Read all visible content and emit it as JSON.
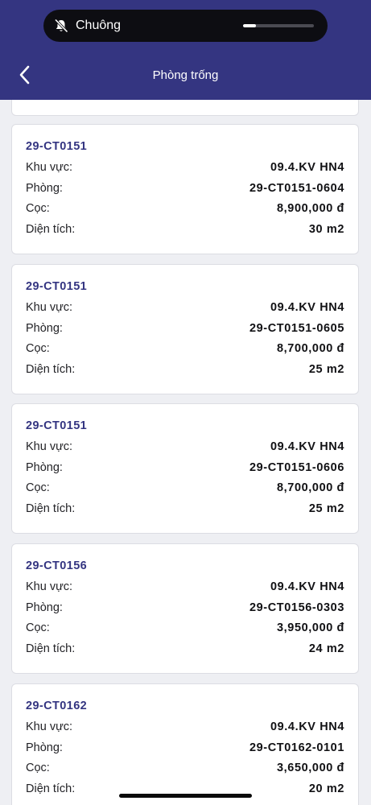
{
  "status": {
    "silent_label": "Chuông",
    "volume_level": 0.18
  },
  "header": {
    "title": "Phòng trống"
  },
  "labels": {
    "area": "Khu vực:",
    "room": "Phòng:",
    "deposit": "Cọc:",
    "size": "Diện tích:"
  },
  "rooms": [
    {
      "code": "29-CT0151",
      "area": "09.4.KV HN4",
      "room": "29-CT0151-0604",
      "deposit": "8,900,000 đ",
      "size": "30 m2"
    },
    {
      "code": "29-CT0151",
      "area": "09.4.KV HN4",
      "room": "29-CT0151-0605",
      "deposit": "8,700,000 đ",
      "size": "25 m2"
    },
    {
      "code": "29-CT0151",
      "area": "09.4.KV HN4",
      "room": "29-CT0151-0606",
      "deposit": "8,700,000 đ",
      "size": "25 m2"
    },
    {
      "code": "29-CT0156",
      "area": "09.4.KV HN4",
      "room": "29-CT0156-0303",
      "deposit": "3,950,000 đ",
      "size": "24 m2"
    },
    {
      "code": "29-CT0162",
      "area": "09.4.KV HN4",
      "room": "29-CT0162-0101",
      "deposit": "3,650,000 đ",
      "size": "20 m2"
    }
  ]
}
